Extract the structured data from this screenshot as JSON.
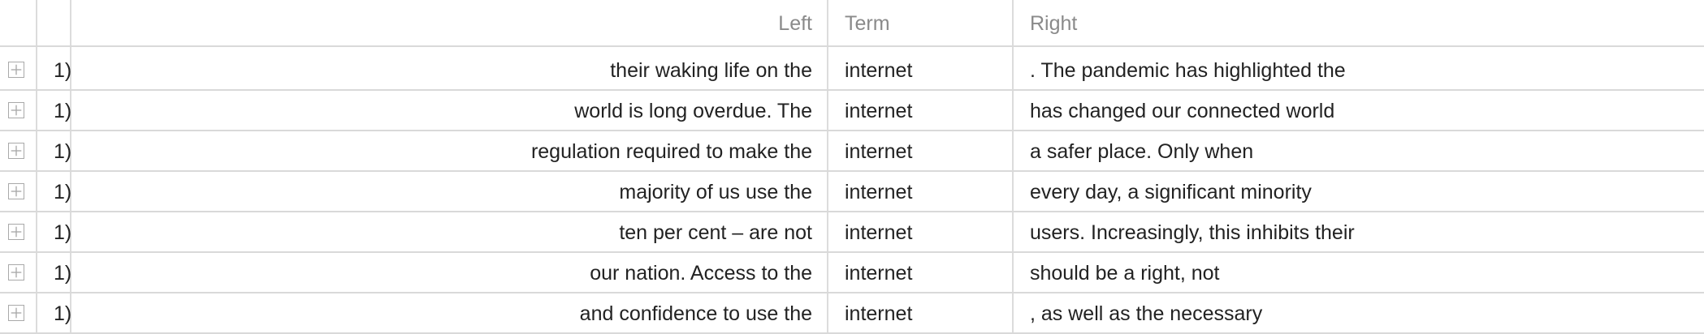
{
  "table": {
    "headers": {
      "left": "Left",
      "term": "Term",
      "right": "Right"
    },
    "rows": [
      {
        "num": "1)",
        "left": "their waking life on the",
        "term": "internet",
        "right": ". The pandemic has highlighted the"
      },
      {
        "num": "1)",
        "left": "world is long overdue. The",
        "term": "internet",
        "right": "has changed our connected world"
      },
      {
        "num": "1)",
        "left": "regulation required to make the",
        "term": "internet",
        "right": "a safer place. Only when"
      },
      {
        "num": "1)",
        "left": "majority of us use the",
        "term": "internet",
        "right": "every day, a significant minority"
      },
      {
        "num": "1)",
        "left": "ten per cent – are not",
        "term": "internet",
        "right": "users. Increasingly, this inhibits their"
      },
      {
        "num": "1)",
        "left": "our nation. Access to the",
        "term": "internet",
        "right": "should be a right, not"
      },
      {
        "num": "1)",
        "left": "and confidence to use the",
        "term": "internet",
        "right": ", as well as the necessary"
      }
    ],
    "row_icon": "plus-box-icon",
    "colors": {
      "grid": "#d9d9d9",
      "header_text": "#8a8a8a",
      "body_text": "#222222"
    }
  }
}
